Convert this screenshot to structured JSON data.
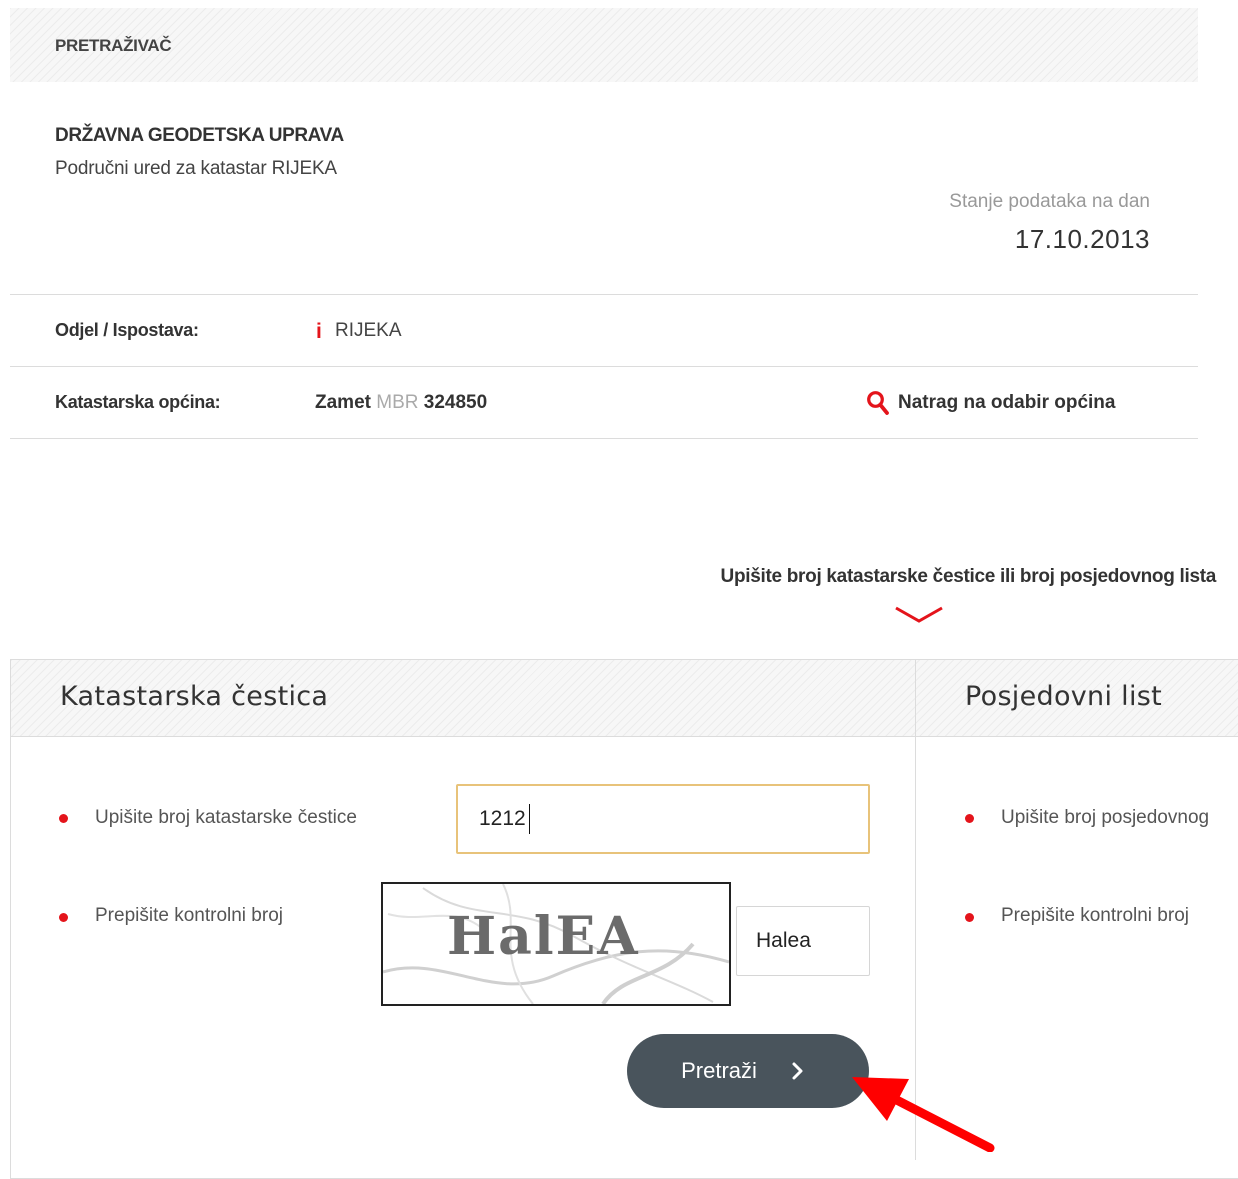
{
  "header": {
    "title": "PRETRAŽIVAČ"
  },
  "organization": {
    "name": "DRŽAVNA GEODETSKA UPRAVA",
    "office": "Područni ured za katastar RIJEKA"
  },
  "data_status": {
    "label": "Stanje podataka na dan",
    "date": "17.10.2013"
  },
  "department": {
    "label": "Odjel / Ispostava:",
    "info_icon_glyph": "i",
    "value": "RIJEKA"
  },
  "municipality": {
    "label": "Katastarska općina:",
    "name": "Zamet",
    "mbr_label": "MBR",
    "mbr_value": "324850",
    "back_link": "Natrag na odabir općina",
    "back_icon": "search-icon"
  },
  "prompt": {
    "text": "Upišite broj katastarske čestice ili broj posjedovnog lista",
    "icon": "chevron-down-icon"
  },
  "parcel_panel": {
    "title": "Katastarska čestica",
    "number_label": "Upišite broj katastarske čestice",
    "number_value": "1212",
    "captcha_label": "Prepišite kontrolni broj",
    "captcha_image_text": "HalEA",
    "captcha_value": "Halea",
    "search_button": "Pretraži"
  },
  "possession_panel": {
    "title": "Posjedovni list",
    "number_label": "Upišite broj posjedovnog",
    "captcha_label": "Prepišite kontrolni broj"
  },
  "colors": {
    "accent_red": "#e4141b",
    "button_bg": "#49545c",
    "input_focus_border": "#e8c37a",
    "divider": "#dcdcdc"
  }
}
